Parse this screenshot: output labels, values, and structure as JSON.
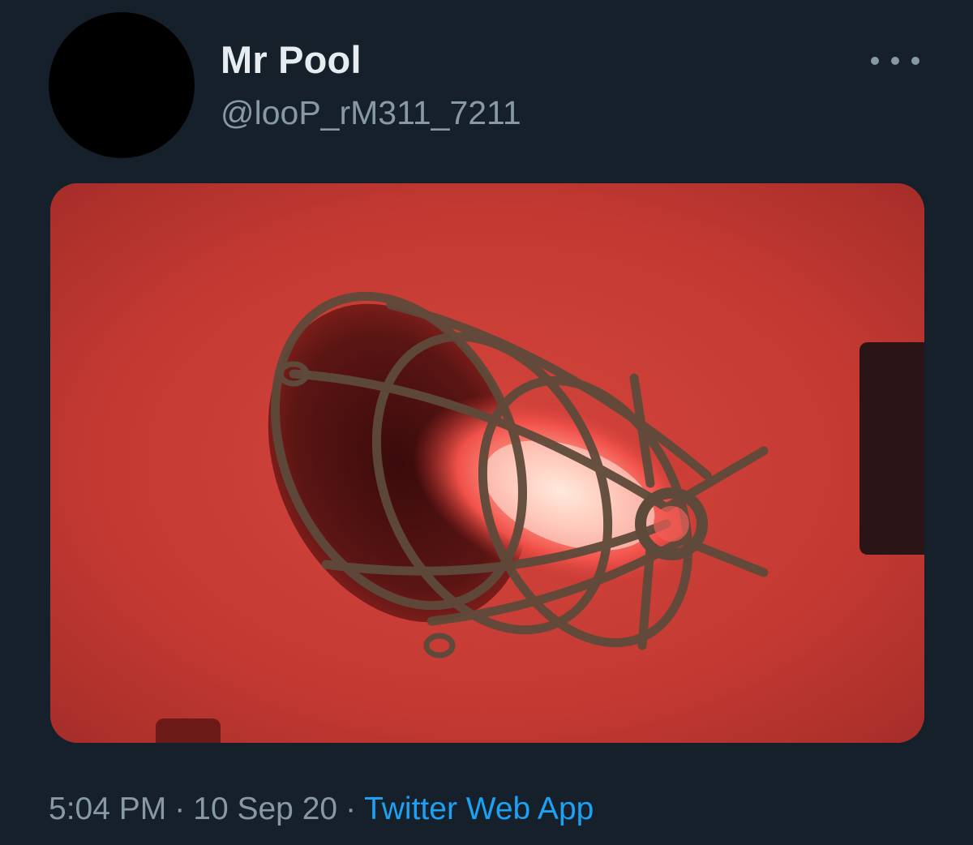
{
  "tweet": {
    "display_name": "Mr Pool",
    "handle": "@looP_rM311_7211",
    "more_icon": "more-dots-icon",
    "media": {
      "kind": "photo",
      "subject": "caged red light bulb"
    },
    "footer": {
      "time": "5:04 PM",
      "separator": "·",
      "date": "10 Sep 20",
      "source": "Twitter Web App"
    }
  },
  "colors": {
    "background": "#16202b",
    "text_primary": "#e6ecf0",
    "text_secondary": "#8899a6",
    "link": "#1da1f2",
    "photo_red": "#c8372f"
  }
}
